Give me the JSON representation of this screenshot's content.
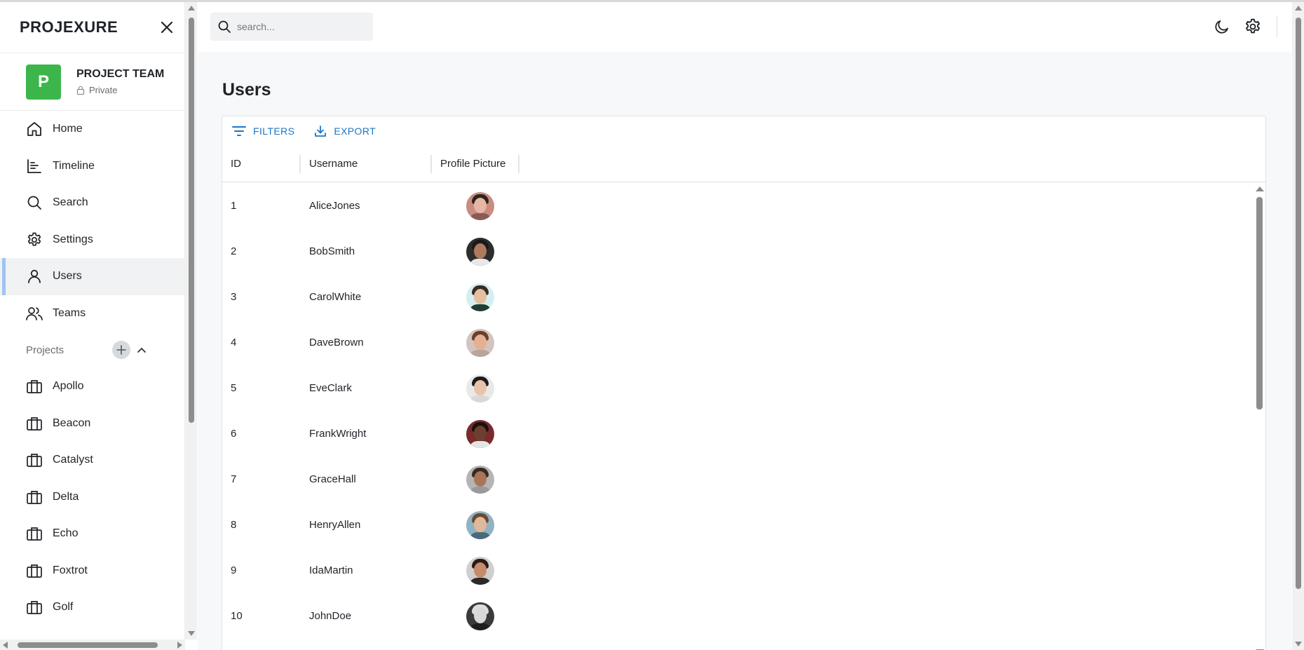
{
  "sidebar": {
    "brand": "PROJEXURE",
    "team": {
      "initial": "P",
      "name": "PROJECT TEAM",
      "visibility": "Private",
      "color": "#3cb64a"
    },
    "nav": [
      {
        "label": "Home",
        "icon": "home-icon"
      },
      {
        "label": "Timeline",
        "icon": "timeline-icon"
      },
      {
        "label": "Search",
        "icon": "search-icon"
      },
      {
        "label": "Settings",
        "icon": "settings-icon"
      },
      {
        "label": "Users",
        "icon": "user-icon",
        "active": true
      },
      {
        "label": "Teams",
        "icon": "teams-icon"
      }
    ],
    "projects_label": "Projects",
    "projects": [
      "Apollo",
      "Beacon",
      "Catalyst",
      "Delta",
      "Echo",
      "Foxtrot",
      "Golf"
    ]
  },
  "topbar": {
    "search_placeholder": "search..."
  },
  "main": {
    "title": "Users",
    "toolbar": {
      "filters": "FILTERS",
      "export": "EXPORT"
    },
    "columns": [
      "ID",
      "Username",
      "Profile Picture"
    ],
    "rows": [
      {
        "id": "1",
        "username": "AliceJones"
      },
      {
        "id": "2",
        "username": "BobSmith"
      },
      {
        "id": "3",
        "username": "CarolWhite"
      },
      {
        "id": "4",
        "username": "DaveBrown"
      },
      {
        "id": "5",
        "username": "EveClark"
      },
      {
        "id": "6",
        "username": "FrankWright"
      },
      {
        "id": "7",
        "username": "GraceHall"
      },
      {
        "id": "8",
        "username": "HenryAllen"
      },
      {
        "id": "9",
        "username": "IdaMartin"
      },
      {
        "id": "10",
        "username": "JohnDoe"
      }
    ]
  },
  "colors": {
    "accent": "#1b76c8",
    "active_bar": "#9fc4f2"
  }
}
